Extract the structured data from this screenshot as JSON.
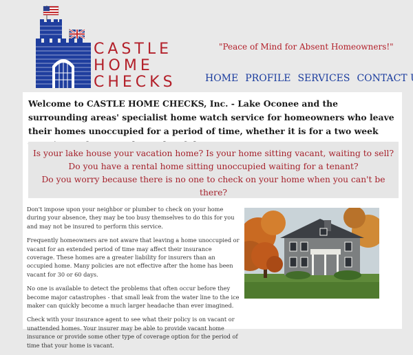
{
  "brand": {
    "line1": "CASTLE",
    "line2": "HOME",
    "line3": "CHECKS",
    "color": "#b3202a",
    "logo_color": "#1f3e9e"
  },
  "tagline": "\"Peace of Mind for Absent Homeowners!\"",
  "nav": {
    "items": [
      "HOME",
      "PROFILE",
      "SERVICES",
      "CONTACT US"
    ]
  },
  "welcome": "Welcome to CASTLE HOME CHECKS, Inc. - Lake Oconee and the surrounding areas' specialist home watch service for homeowners who leave their homes unoccupied for a period of time, whether it is for a two week vacation or for several months of the year.",
  "callout": {
    "lines": [
      "Is your lake house your vacation home? Is your home sitting vacant, waiting to sell?",
      "Do you have a rental home sitting unoccupied waiting for a tenant?",
      "Do you worry because there is no one to check on your home when you can't be there?"
    ]
  },
  "paragraphs": [
    "Don't impose upon your neighbor or plumber to check on your home during your absence, they may be too busy themselves to do this for you and may not be insured to perform this service.",
    "Frequently homeowners are not aware that leaving a home unoccupied or vacant for an extended period of time may affect their insurance coverage.  These homes are a greater liability for insurers than an occupied home. Many policies are not effective after the home has been vacant for 30 or 60 days.",
    "No one is available to detect the problems that often occur before they become major catastrophes - that small leak from the water line to the ice maker can quickly become a much larger headache than ever imagined.",
    "Check with your insurance agent to see what their policy is on vacant or unattended homes.  Your insurer may be able to provide vacant home insurance or provide some other type of coverage option for the period of time that your home is vacant."
  ],
  "photo": {
    "icon": "house-photo"
  }
}
